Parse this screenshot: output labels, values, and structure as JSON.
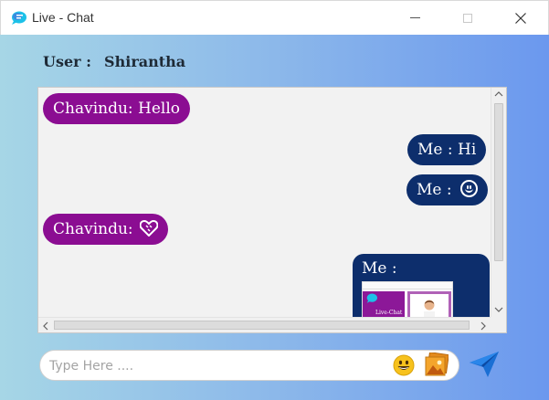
{
  "window": {
    "title": "Live - Chat"
  },
  "user": {
    "label": "User :",
    "name": "Shirantha"
  },
  "messages": [
    {
      "side": "in",
      "text": "Chavindu: Hello"
    },
    {
      "side": "out",
      "text": "Me : Hi"
    },
    {
      "side": "out",
      "text": "Me :",
      "emoji": "smiling-face-icon"
    },
    {
      "side": "in",
      "text": "Chavindu:",
      "emoji": "heart-icon"
    },
    {
      "side": "out",
      "text": "Me :",
      "attachment": "image-thumbnail",
      "thumbnail_text": "Live-Chat"
    }
  ],
  "composer": {
    "placeholder": "Type Here ....",
    "value": ""
  },
  "icons": {
    "app": "chat-bubble-icon",
    "emoji_button": "emoji-icon",
    "image_button": "image-icon",
    "send_button": "send-icon"
  },
  "colors": {
    "incoming_bubble": "#8b0d92",
    "outgoing_bubble": "#0d2e6c",
    "gradient_start": "#a6d6e6",
    "gradient_end": "#6b98ee"
  }
}
